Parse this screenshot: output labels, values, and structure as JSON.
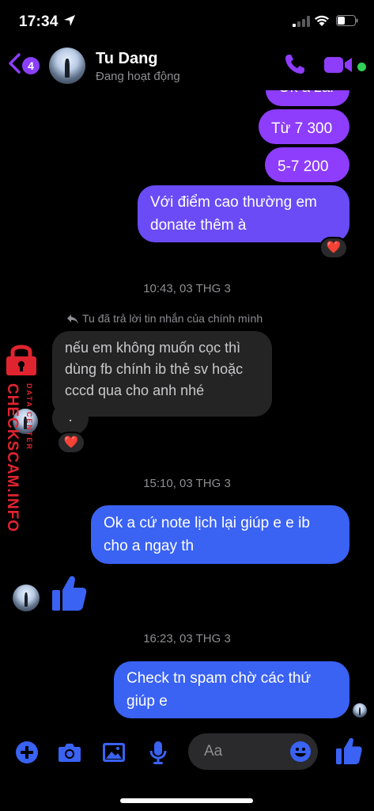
{
  "status_bar": {
    "time": "17:34"
  },
  "header": {
    "back_badge": "4",
    "contact_name": "Tu Dang",
    "contact_status": "Đang hoạt động"
  },
  "messages": {
    "sent_1": "Ok a zai",
    "sent_2": "Từ 7 300",
    "sent_3": "5-7 200",
    "sent_4_line1": "Với điểm cao thường em",
    "sent_4_line2": "donate thêm à",
    "timestamp_1": "10:43, 03 THG 3",
    "reply_note": "Tu đã trả lời tin nhắn của chính mình",
    "recv_1_line1": "nếu em không muốn cọc thì",
    "recv_1_line2": "dùng fb chính ib thẻ sv hoặc",
    "recv_1_line3": "cccd qua cho anh nhé",
    "recv_2": ".",
    "timestamp_2": "15:10, 03 THG 3",
    "sent_5_line1": "Ok a cứ note lịch lại giúp e e ib",
    "sent_5_line2": "cho a ngay th",
    "timestamp_3": "16:23, 03 THG 3",
    "sent_6_line1": "Check tn spam chờ các thứ",
    "sent_6_line2": "giúp e"
  },
  "reactions": {
    "heart": "❤️"
  },
  "watermark": {
    "main": "CHECKSCAM.INFO",
    "small": "DATA CENTER"
  },
  "composer": {
    "placeholder": "Aa"
  },
  "colors": {
    "accent": "#8d3dfb",
    "sent_blue": "#3a62f3",
    "online": "#31d158",
    "watermark": "#e0242f"
  }
}
